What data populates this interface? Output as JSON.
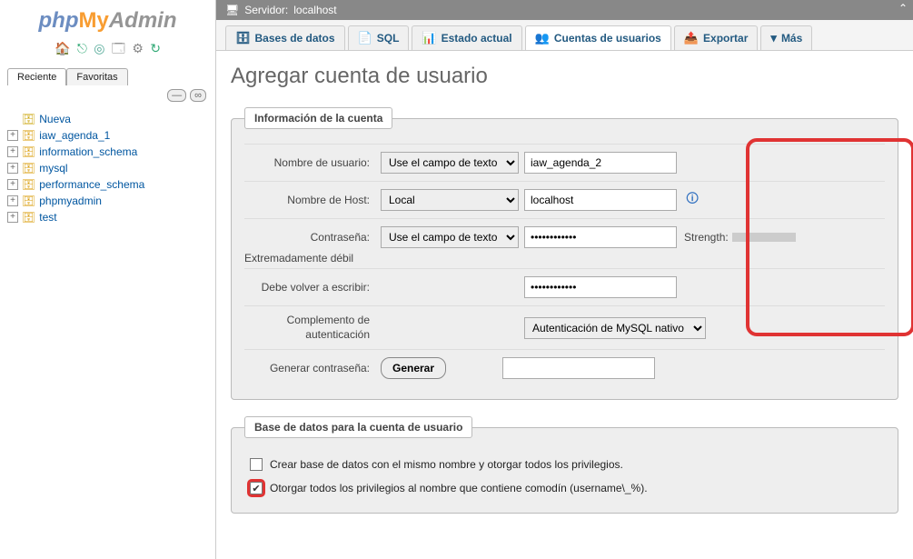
{
  "logo": {
    "p1": "php",
    "p2": "My",
    "p3": "Admin"
  },
  "sidebar": {
    "tabs": {
      "recent": "Reciente",
      "favorites": "Favoritas"
    },
    "new_label": "Nueva",
    "databases": [
      {
        "name": "iaw_agenda_1"
      },
      {
        "name": "information_schema"
      },
      {
        "name": "mysql"
      },
      {
        "name": "performance_schema"
      },
      {
        "name": "phpmyadmin"
      },
      {
        "name": "test"
      }
    ]
  },
  "server": {
    "label": "Servidor:",
    "name": "localhost"
  },
  "navtabs": [
    {
      "label": "Bases de datos"
    },
    {
      "label": "SQL"
    },
    {
      "label": "Estado actual"
    },
    {
      "label": "Cuentas de usuarios"
    },
    {
      "label": "Exportar"
    },
    {
      "label": "Más"
    }
  ],
  "page_title": "Agregar cuenta de usuario",
  "fieldset1": {
    "legend": "Información de la cuenta",
    "username_label": "Nombre de usuario:",
    "username_select": "Use el campo de texto",
    "username_value": "iaw_agenda_2",
    "host_label": "Nombre de Host:",
    "host_select": "Local",
    "host_value": "localhost",
    "password_label": "Contraseña:",
    "password_select": "Use el campo de texto",
    "password_value": "••••••••••••",
    "strength_label": "Strength:",
    "strength_text": "Extremadamente débil",
    "retype_label": "Debe volver a escribir:",
    "retype_value": "••••••••••••",
    "authplugin_label": "Complemento de autenticación",
    "authplugin_select": "Autenticación de MySQL nativo",
    "genpass_label": "Generar contraseña:",
    "genpass_button": "Generar"
  },
  "fieldset2": {
    "legend": "Base de datos para la cuenta de usuario",
    "opt1": "Crear base de datos con el mismo nombre y otorgar todos los privilegios.",
    "opt2": "Otorgar todos los privilegios al nombre que contiene comodín (username\\_%)."
  }
}
